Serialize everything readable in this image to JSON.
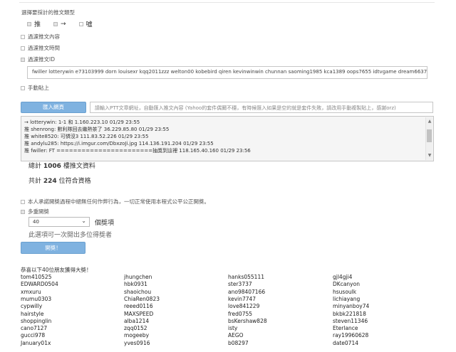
{
  "section_title": "選擇要採計的推文類型",
  "push_types": [
    {
      "label": "推",
      "checked": true
    },
    {
      "label": "→",
      "checked": true
    },
    {
      "label": "噓",
      "checked": false
    }
  ],
  "filters": [
    {
      "label": "過濾推文內容",
      "checked": false
    },
    {
      "label": "過濾推文時間",
      "checked": false
    },
    {
      "label": "過濾推文ID",
      "checked": true
    }
  ],
  "filter_id_value": "fwiller lotterywin e73103999 dorn louisexr kqq2011zzz welton00 kobebird qiren kevinwinwin chunnan saoming1985 kca1389 oops7655 idtvgame dream66377 weiguilty mavs",
  "manual_paste_label": "手動貼上",
  "import_button_label": "匯入網頁",
  "url_placeholder": "請輸入PTT文章網址，自動匯入推文內容 (Yahoo的套件偶爾不穩，有時候匯入如果是空的就是套件失敗，請改用手動複製貼上，感謝orz)",
  "push_lines": [
    "→ lotterywin: 1-1 和            1.160.223.10 01/29 23:55",
    "推 shenrong: 數利隊回去繼熱茶了              36.229.85.80 01/29 23:55",
    "推 white8520: 可憐沒3              111.83.52.226 01/29 23:55",
    "推 andylu285: https://i.imgur.com/DbxzoJi.jpg       114.136.191.204 01/29 23:55",
    "推 fwiller: FT =======================抽獎到這裡     118.165.40.160 01/29 23:56"
  ],
  "stats": {
    "total_prefix": "總計",
    "total_count": "1006",
    "total_suffix": "樓推文資料",
    "eligible_prefix": "共計",
    "eligible_count": "224",
    "eligible_suffix": "位符合資格"
  },
  "agree_label": "本人承諾開獎過程中絕無任何作弊行為，一切正常使用本程式公平公正開獎。",
  "multi_draw_label": "多重開獎",
  "winner_count_select": "40",
  "winner_count_label": "個獎項",
  "multi_hint": "此選項可一次開出多位得獎者",
  "start_button_label": "開獎！",
  "winners_title": "恭喜以下40位朋友獲得大獎！",
  "winners": [
    [
      "tom410525",
      "jhungchen",
      "hanks055111",
      "gjl4gji4"
    ],
    [
      "EDWARD0504",
      "hbk0931",
      "ster3737",
      "DKcanyon"
    ],
    [
      "xmxuru",
      "shaoichou",
      "ano98407166",
      "hsusoulk"
    ],
    [
      "mumu0303",
      "ChiaRen0823",
      "kevin7747",
      "lichiayang"
    ],
    [
      "cypwilly",
      "reeed0116",
      "love841229",
      "minyanboy74"
    ],
    [
      "hairstyle",
      "MAXSPEED",
      "fred0755",
      "bkbk221818"
    ],
    [
      "shoppinglin",
      "alba1214",
      "bsKershaw828",
      "steven11346"
    ],
    [
      "cano7127",
      "zqq0152",
      "isty",
      "Eterlance"
    ],
    [
      "gucci978",
      "mogeeby",
      "AEGO",
      "ray19960628"
    ],
    [
      "January01x",
      "yves0916",
      "b08297",
      "date0714"
    ]
  ]
}
